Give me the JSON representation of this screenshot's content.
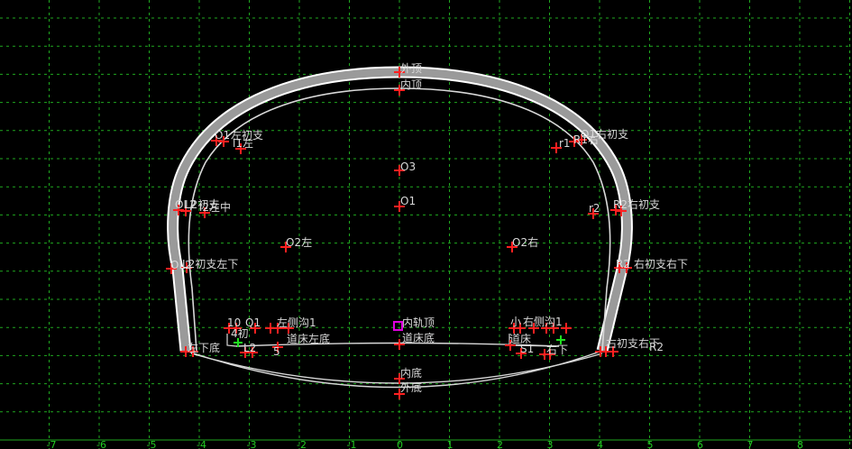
{
  "colors": {
    "background": "#000000",
    "grid": "#1fa81f",
    "lining": "#ffffff",
    "lining_fill": "#9a9a9a",
    "point": "#ff2020",
    "label": "#d8d8d8",
    "axis_tick": "#22cc22",
    "special_point": "#e000e0",
    "special_point_alt": "#20e020"
  },
  "axis": {
    "x_ticks": [
      "-7",
      "-6",
      "-5",
      "-4",
      "-3",
      "-2",
      "-1",
      "0",
      "1",
      "2",
      "3",
      "4",
      "5",
      "6",
      "7",
      "8"
    ]
  },
  "labels": {
    "outer_top": "外顶",
    "inner_top": "内顶",
    "o3": "O3",
    "o1": "O1",
    "o2_left": "O2左",
    "o2_right": "O2右",
    "left_arch_a": "O1",
    "left_arch_b": "左初支",
    "left_arch_c": "l1左",
    "right_arch_a": "r1",
    "right_arch_b": "O1右初支",
    "right_arch_c": "R1右",
    "left_wall_a": "OL2",
    "left_wall_b": "L2初支",
    "left_wall_c": "l2左中",
    "right_wall_a": "r2",
    "right_wall_b": "R2右初支",
    "left_low_a": "OL2",
    "left_low_b": "L2初支左下",
    "right_low_a": "R2",
    "right_low_b": "右初支右下",
    "left_cluster_1": "10",
    "left_cluster_2": "Q1",
    "left_cluster_3": "左侧沟1",
    "left_cluster_4": "道床左底",
    "left_cluster_5": "5",
    "left_cluster_6": "4初",
    "left_cluster_7": "左下底",
    "left_cluster_8": "L2",
    "right_cluster_1": "小",
    "right_cluster_2": "右侧沟1",
    "right_cluster_3": "道床",
    "right_cluster_4": "S1",
    "right_cluster_5": "右下",
    "right_cluster_6": "右初支右下",
    "right_cluster_7": "R2",
    "inner_rail_top": "内轨顶",
    "bed_bottom": "道床底",
    "inner_bottom": "内底",
    "outer_bottom": "外底"
  }
}
